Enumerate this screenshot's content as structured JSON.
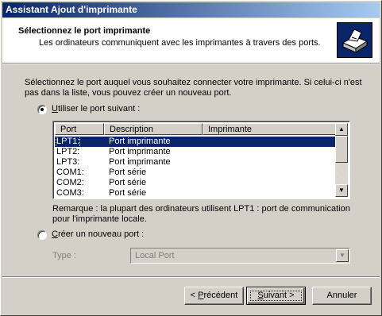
{
  "window": {
    "title": "Assistant Ajout d'imprimante"
  },
  "header": {
    "title": "Sélectionnez le port imprimante",
    "subtitle": "Les ordinateurs communiquent avec les imprimantes à travers des ports.",
    "icon": "printer-wizard-icon"
  },
  "intro": "Sélectionnez le port auquel vous souhaitez connecter votre imprimante. Si celui-ci n'est pas dans la liste, vous pouvez créer un nouveau port.",
  "option_existing": {
    "underline": "U",
    "rest": "tiliser le port suivant :",
    "selected": true
  },
  "ports_table": {
    "columns": [
      "Port",
      "Description",
      "Imprimante"
    ],
    "rows": [
      {
        "port": "LPT1:",
        "description": "Port imprimante",
        "printer": "",
        "selected": true
      },
      {
        "port": "LPT2:",
        "description": "Port imprimante",
        "printer": ""
      },
      {
        "port": "LPT3:",
        "description": "Port imprimante",
        "printer": ""
      },
      {
        "port": "COM1:",
        "description": "Port série",
        "printer": ""
      },
      {
        "port": "COM2:",
        "description": "Port série",
        "printer": ""
      },
      {
        "port": "COM3:",
        "description": "Port série",
        "printer": ""
      }
    ]
  },
  "note": "Remarque : la plupart des ordinateurs utilisent LPT1 : port de communication pour l'imprimante locale.",
  "option_new": {
    "underline": "C",
    "rest": "réer un nouveau port :",
    "selected": false
  },
  "type": {
    "label": "Type :",
    "value": "Local Port"
  },
  "buttons": {
    "back_prefix": "< ",
    "back_underline": "P",
    "back_rest": "récédent",
    "next_underline": "S",
    "next_rest": "uivant >",
    "cancel": "Annuler"
  }
}
